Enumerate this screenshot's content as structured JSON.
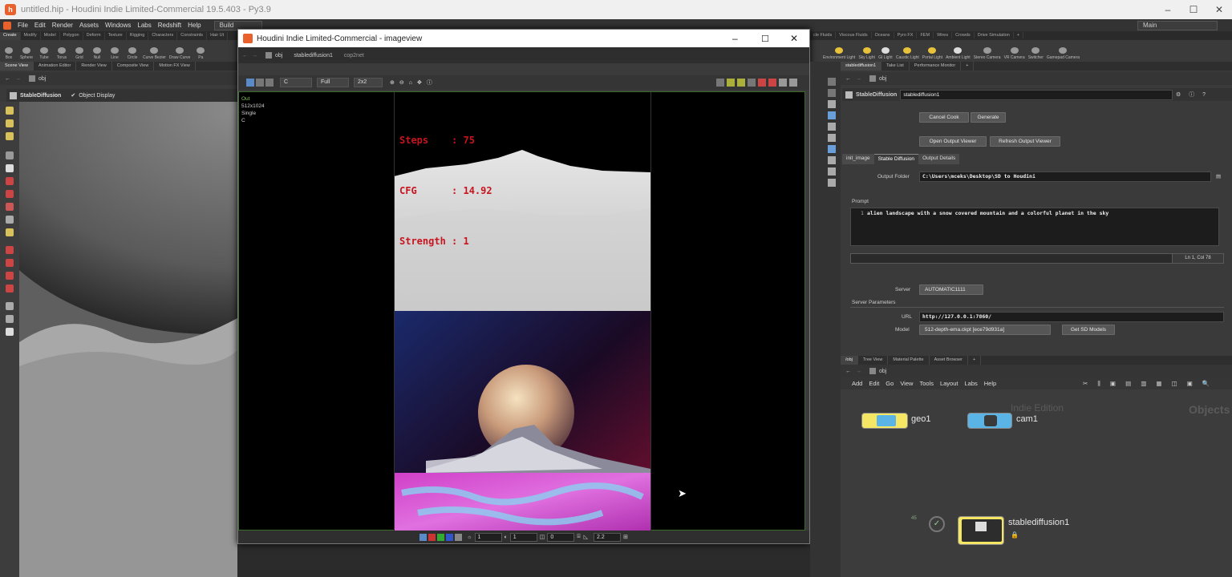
{
  "window": {
    "title": "untitled.hip - Houdini Indie Limited-Commercial 19.5.403 - Py3.9",
    "controls": [
      "–",
      "☐",
      "✕"
    ]
  },
  "menubar": {
    "items": [
      "File",
      "Edit",
      "Render",
      "Assets",
      "Windows",
      "Labs",
      "Redshift",
      "Help"
    ],
    "build": "Build",
    "desktop": "Main",
    "desktop_right": "Main"
  },
  "shelf": {
    "tabs": [
      "Create",
      "Modify",
      "Model",
      "Polygon",
      "Deform",
      "Texture",
      "Rigging",
      "Characters",
      "Constraints",
      "Hair Ut"
    ],
    "tools": [
      "Box",
      "Sphere",
      "Tube",
      "Torus",
      "Grid",
      "Null",
      "Line",
      "Circle",
      "Curve Bezier",
      "Draw Curve",
      "Pa"
    ],
    "right_tabs": [
      "cle Fluids",
      "Viscous Fluids",
      "Oceans",
      "Pyro FX",
      "FEM",
      "Wires",
      "Crowds",
      "Drive Simulation",
      "+"
    ],
    "right_tools": [
      "Environment Light",
      "Sky Light",
      "GI Light",
      "Caustic Light",
      "Portal Light",
      "Ambient Light",
      "Stereo Camera",
      "VR Camera",
      "Switcher",
      "Gamepad Camera"
    ]
  },
  "left_pane": {
    "tabs": [
      "Scene View",
      "Animation Editor",
      "Render View",
      "Composite View",
      "Motion FX View"
    ],
    "path": "obj",
    "viewport_node": "StableDiffusion",
    "viewport_mode": "Object Display"
  },
  "imageview": {
    "title": "Houdini Indie Limited-Commercial - imageview",
    "controls": [
      "–",
      "☐",
      "✕"
    ],
    "path": [
      "obj",
      "stablediffusion1",
      "cop2net"
    ],
    "plane": "C",
    "resolution": "Full",
    "layout": "2x2",
    "info": [
      "Out",
      "512x1024",
      "Single",
      "C"
    ],
    "overlay": {
      "steps": "Steps    : 75",
      "cfg": "CFG      : 14.92",
      "strength": "Strength : 1"
    },
    "bottom": {
      "v1": "1",
      "v2": "1",
      "v3": "0",
      "gamma": "2.2"
    }
  },
  "right_pane": {
    "tabs": [
      "stablediffusion1",
      "Take List",
      "Performance Monitor",
      "+"
    ],
    "path": "obj",
    "node_type": "StableDiffusion",
    "node_name": "stablediffusion1",
    "buttons": {
      "cancel": "Cancel Cook",
      "generate": "Generate",
      "open_output": "Open Output Viewer",
      "refresh_output": "Refresh Output Viewer"
    },
    "param_tabs": [
      "init_image",
      "Stable Diffusion",
      "Output Details"
    ],
    "output_folder_label": "Output Folder",
    "output_folder": "C:\\Users\\mceks\\Desktop\\SD to Houdini",
    "prompt_label": "Prompt",
    "prompt_line": "1",
    "prompt": "alien landscape with a snow covered mountain and a colorful planet in the sky",
    "cursor_pos": "Ln 1, Col 78",
    "server_label": "Server",
    "server": "AUTOMATIC1111",
    "server_params": "Server Parameters",
    "url_label": "URL",
    "url": "http://127.0.0.1:7860/",
    "model_label": "Model",
    "model": "512-depth-ema.ckpt [ece79d931a]",
    "get_models": "Get SD Models"
  },
  "network": {
    "tabs": [
      "/obj",
      "Tree View",
      "Material Palette",
      "Asset Browser",
      "+"
    ],
    "path": "obj",
    "menu": [
      "Add",
      "Edit",
      "Go",
      "View",
      "Tools",
      "Layout",
      "Labs",
      "Help"
    ],
    "watermark": "Indie Edition",
    "context": "Objects",
    "nodes": {
      "geo": "geo1",
      "cam": "cam1",
      "sd": "stablediffusion1"
    },
    "cook_count": "45"
  },
  "colors": {
    "accent": "#e8612c",
    "overlay_text": "#c8141e",
    "node_yellow": "#f5e663",
    "node_blue": "#5bb4e6"
  }
}
